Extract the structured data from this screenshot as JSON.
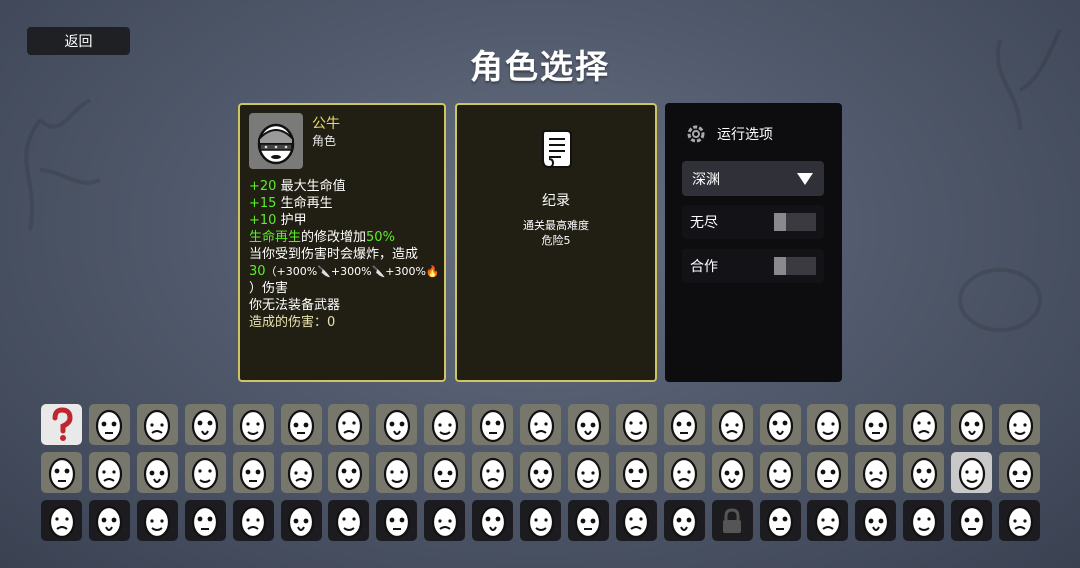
{
  "back_label": "返回",
  "title": "角色选择",
  "character": {
    "name": "公牛",
    "type": "角色",
    "stats": [
      {
        "value": "+20",
        "label": "最大生命值"
      },
      {
        "value": "+15",
        "label": "生命再生"
      },
      {
        "value": "+10",
        "label": "护甲"
      }
    ],
    "modifier_prefix": "生命再生",
    "modifier_mid": "的修改增加",
    "modifier_pct": "50%",
    "explode_line": "当你受到伤害时会爆炸，造成",
    "damage_base": "30",
    "damage_scaling": "（+300%🔪+300%🔪+300%🔥",
    "damage_end": "）伤害",
    "no_weapon": "你无法装备武器",
    "damage_dealt": "造成的伤害：0"
  },
  "record": {
    "title": "纪录",
    "line1": "通关最高难度",
    "line2": "危险5",
    "icon": "scroll-icon"
  },
  "options": {
    "header": "运行选项",
    "header_icon": "settings-icon",
    "mode_selected": "深渊",
    "toggles": [
      {
        "label": "无尽",
        "on": false
      },
      {
        "label": "合作",
        "on": false
      }
    ]
  },
  "grid": {
    "rows": [
      {
        "dark": false,
        "count": 21
      },
      {
        "dark": false,
        "count": 21
      },
      {
        "dark": true,
        "count": 21
      }
    ],
    "special": {
      "question": [
        0,
        0
      ],
      "selected": [
        1,
        19
      ],
      "locked": [
        2,
        14
      ]
    }
  }
}
